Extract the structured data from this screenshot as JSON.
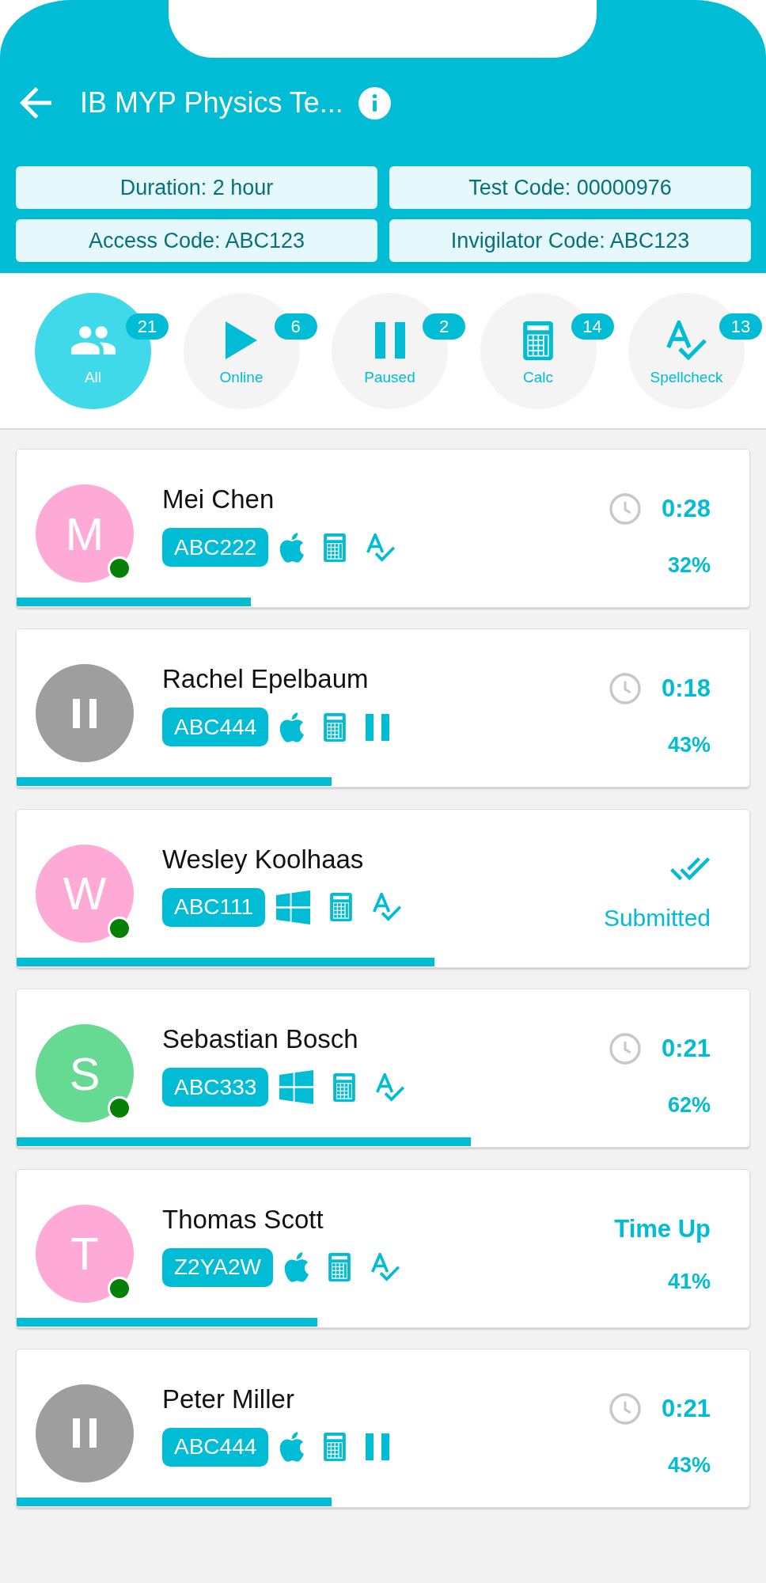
{
  "header": {
    "title": "IB MYP Physics Te...",
    "info_chips": [
      "Duration: 2 hour",
      "Test Code: 00000976",
      "Access Code: ABC123",
      "Invigilator Code: ABC123"
    ]
  },
  "filters": [
    {
      "kind": "all",
      "label": "All",
      "count": "21",
      "selected": true
    },
    {
      "kind": "online",
      "label": "Online",
      "count": "6",
      "selected": false
    },
    {
      "kind": "paused",
      "label": "Paused",
      "count": "2",
      "selected": false
    },
    {
      "kind": "calculator",
      "label": "Calc",
      "count": "14",
      "selected": false
    },
    {
      "kind": "spellcheck",
      "label": "Spellcheck",
      "count": "13",
      "selected": false
    }
  ],
  "students": [
    {
      "name": "Mei Chen",
      "avatar": {
        "kind": "initial",
        "initial": "M",
        "color": "#ffaad6"
      },
      "online": true,
      "code": "ABC222",
      "icons": [
        {
          "kind": "apple"
        },
        {
          "kind": "calculator"
        },
        {
          "kind": "spellcheck"
        }
      ],
      "status": {
        "kind": "timer",
        "time": "0:28",
        "percent": "32%"
      },
      "level": 0.32
    },
    {
      "name": "Rachel Epelbaum",
      "avatar": {
        "kind": "paused",
        "color": "#9e9e9e"
      },
      "online": false,
      "code": "ABC444",
      "icons": [
        {
          "kind": "apple"
        },
        {
          "kind": "calculator"
        },
        {
          "kind": "paused"
        }
      ],
      "status": {
        "kind": "timer",
        "time": "0:18",
        "percent": "43%"
      },
      "level": 0.43
    },
    {
      "name": "Wesley Koolhaas",
      "avatar": {
        "kind": "initial",
        "initial": "W",
        "color": "#ffaad6"
      },
      "online": true,
      "code": "ABC111",
      "icons": [
        {
          "kind": "windows"
        },
        {
          "kind": "calculator"
        },
        {
          "kind": "spellcheck"
        }
      ],
      "status": {
        "kind": "submitted",
        "label": "Submitted"
      },
      "level": 0.57
    },
    {
      "name": "Sebastian Bosch",
      "avatar": {
        "kind": "initial",
        "initial": "S",
        "color": "#66d993"
      },
      "online": true,
      "code": "ABC333",
      "icons": [
        {
          "kind": "windows"
        },
        {
          "kind": "calculator"
        },
        {
          "kind": "spellcheck"
        }
      ],
      "status": {
        "kind": "timer",
        "time": "0:21",
        "percent": "62%"
      },
      "level": 0.62
    },
    {
      "name": "Thomas Scott",
      "avatar": {
        "kind": "initial",
        "initial": "T",
        "color": "#ffaad6"
      },
      "online": true,
      "code": "Z2YA2W",
      "icons": [
        {
          "kind": "apple"
        },
        {
          "kind": "calculator"
        },
        {
          "kind": "spellcheck"
        }
      ],
      "status": {
        "kind": "time_up",
        "label": "Time Up",
        "percent": "41%"
      },
      "level": 0.41
    },
    {
      "name": "Peter Miller",
      "avatar": {
        "kind": "paused",
        "color": "#9e9e9e"
      },
      "online": false,
      "code": "ABC444",
      "icons": [
        {
          "kind": "apple"
        },
        {
          "kind": "calculator"
        },
        {
          "kind": "paused"
        }
      ],
      "status": {
        "kind": "timer",
        "time": "0:21",
        "percent": "43%"
      },
      "level": 0.43
    }
  ]
}
